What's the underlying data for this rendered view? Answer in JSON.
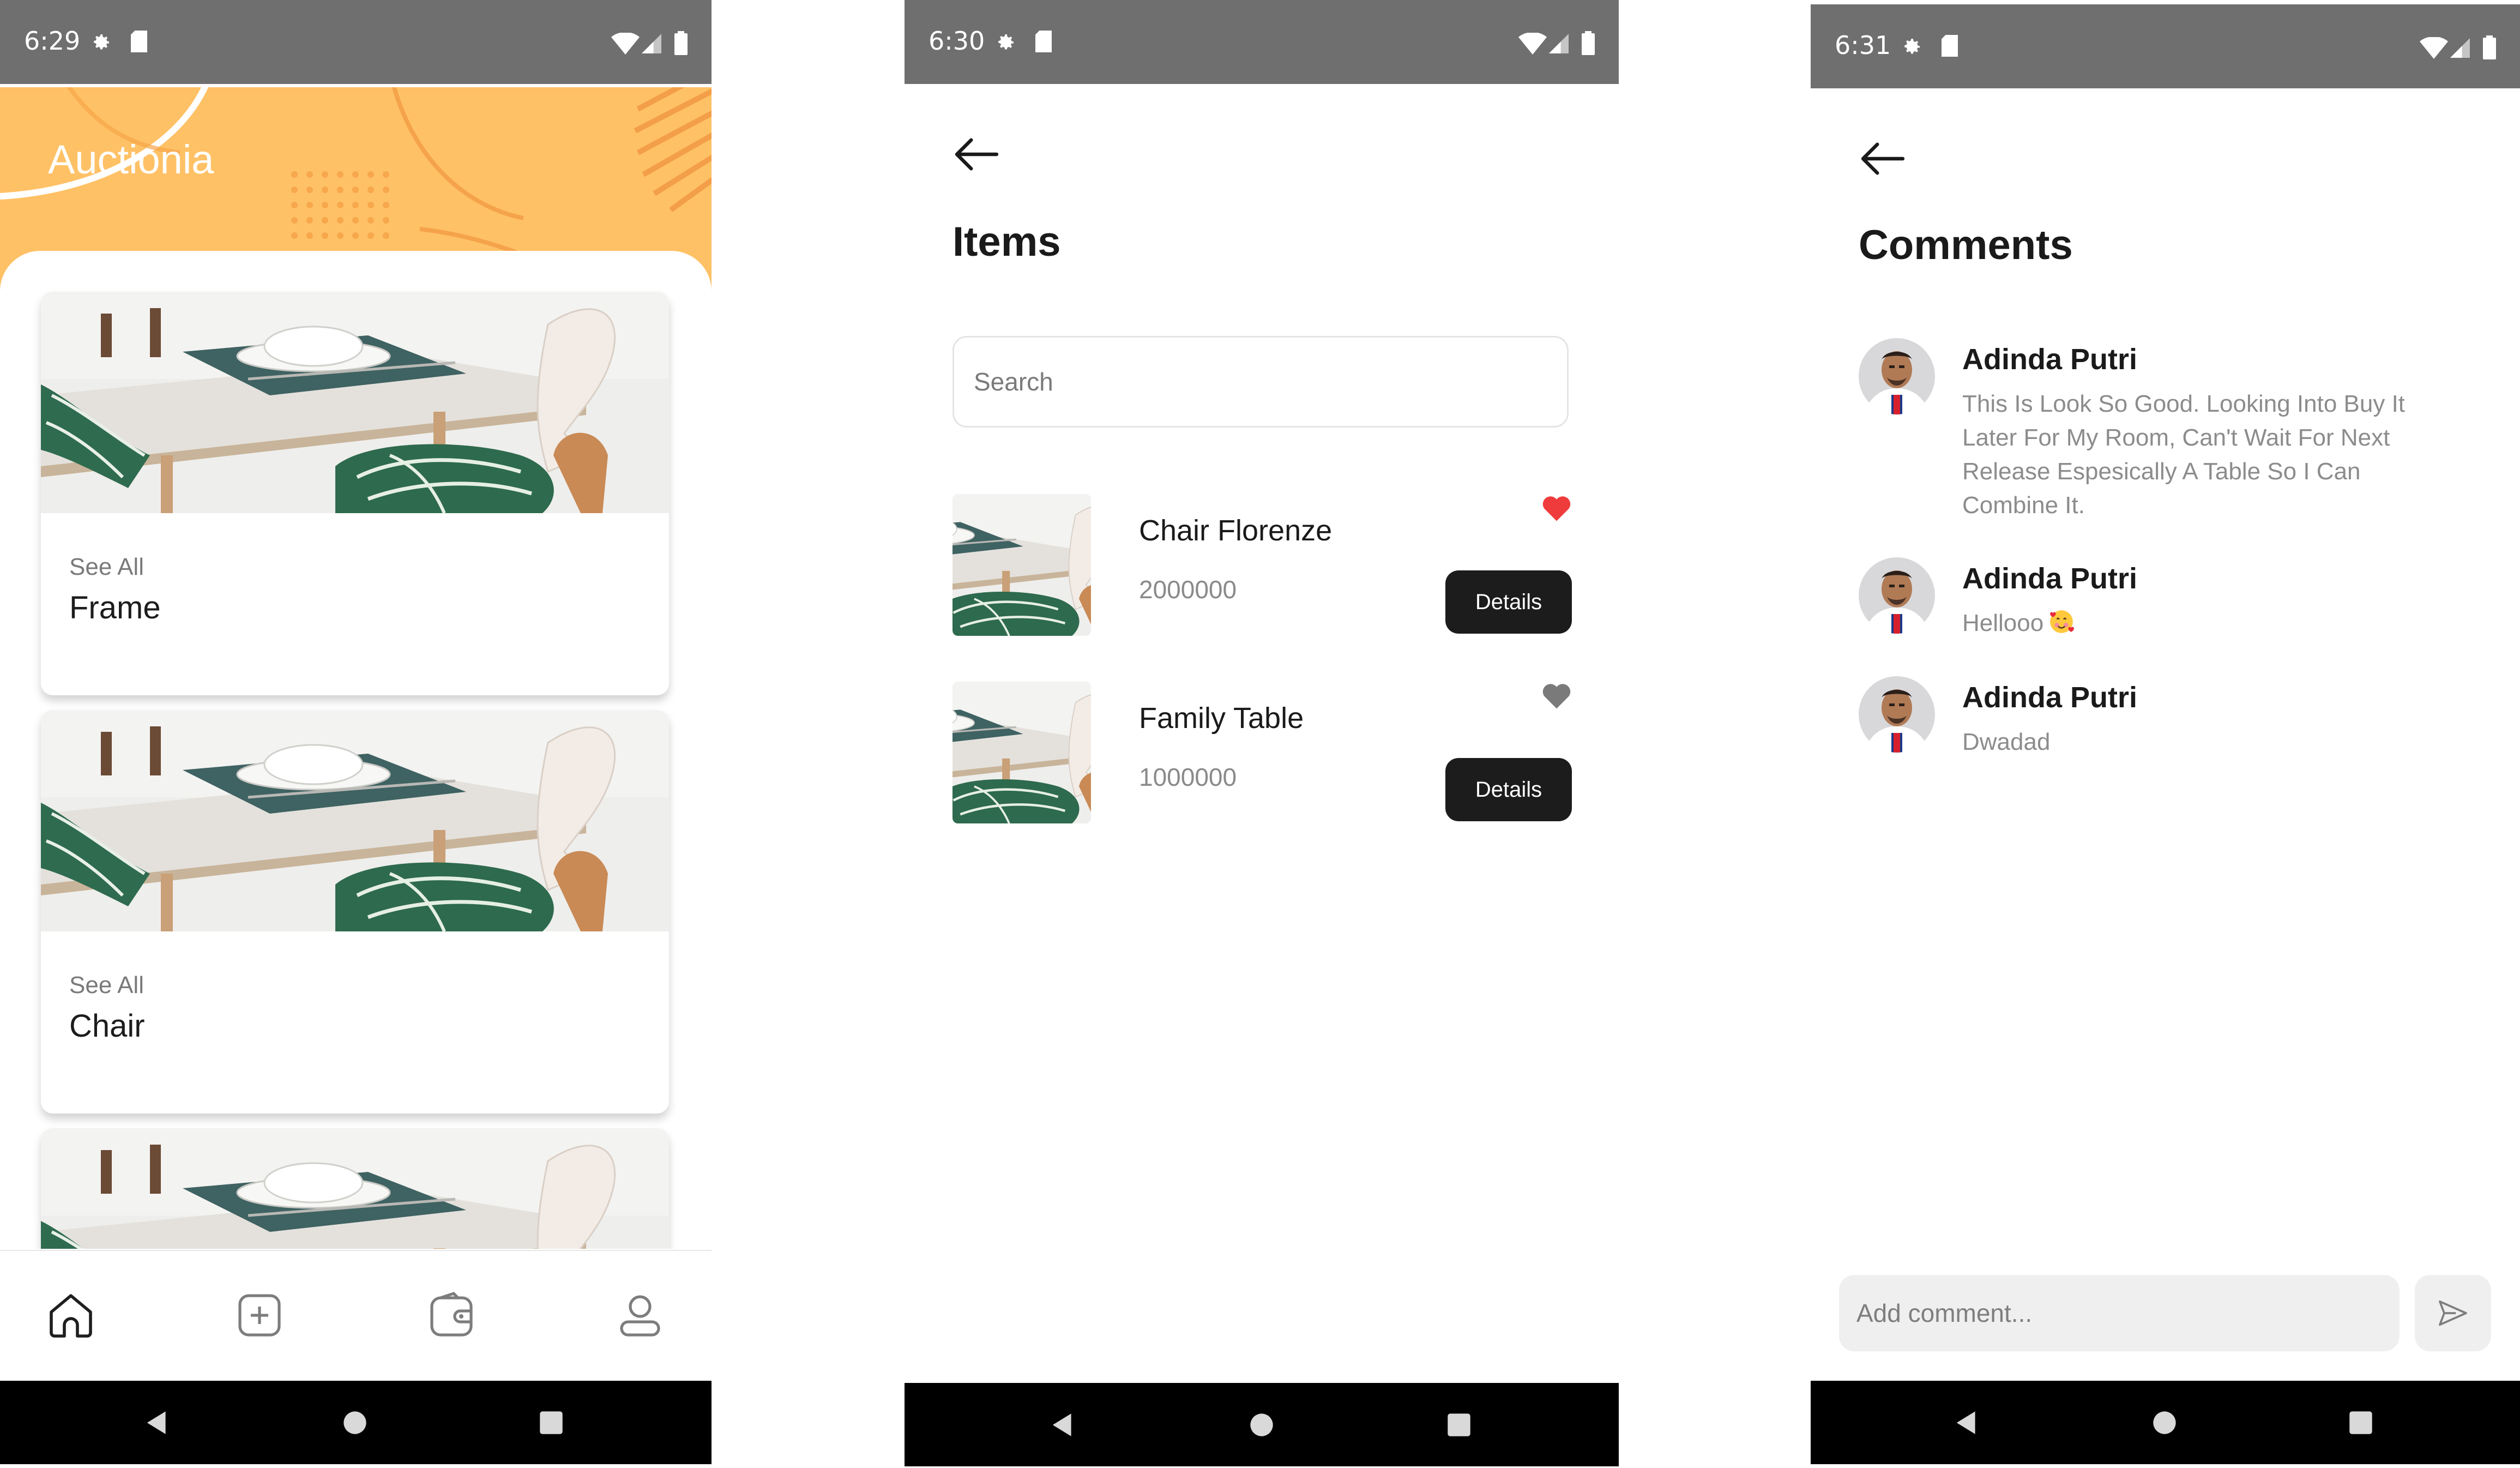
{
  "screens": {
    "home": {
      "status_time": "6:29",
      "app_title": "Auctionia",
      "cards": [
        {
          "see_all": "See All",
          "category": "Frame"
        },
        {
          "see_all": "See All",
          "category": "Chair"
        },
        {
          "see_all": "",
          "category": ""
        }
      ],
      "tabs": [
        "home-icon",
        "add-square-icon",
        "wallet-icon",
        "profile-icon"
      ]
    },
    "items": {
      "status_time": "6:30",
      "title": "Items",
      "search_placeholder": "Search",
      "list": [
        {
          "name": "Chair Florenze",
          "price": "2000000",
          "favorited": true,
          "details_label": "Details"
        },
        {
          "name": "Family Table",
          "price": "1000000",
          "favorited": false,
          "details_label": "Details"
        }
      ]
    },
    "comments": {
      "status_time": "6:31",
      "title": "Comments",
      "list": [
        {
          "author": "Adinda Putri",
          "text": "This Is Look So Good. Looking Into Buy It Later For My Room, Can't Wait For Next Release Espesically A Table So I Can Combine It."
        },
        {
          "author": "Adinda Putri",
          "text": "Hellooo"
        },
        {
          "author": "Adinda Putri",
          "text": "Dwadad"
        }
      ],
      "input_placeholder": "Add comment..."
    }
  },
  "colors": {
    "accent_orange": "#ffc166",
    "status_bar": "#6f6f6f",
    "favorite_red": "#ef3b3b",
    "favorite_gray": "#7a7a7a",
    "button_dark": "#1c1c1c"
  }
}
